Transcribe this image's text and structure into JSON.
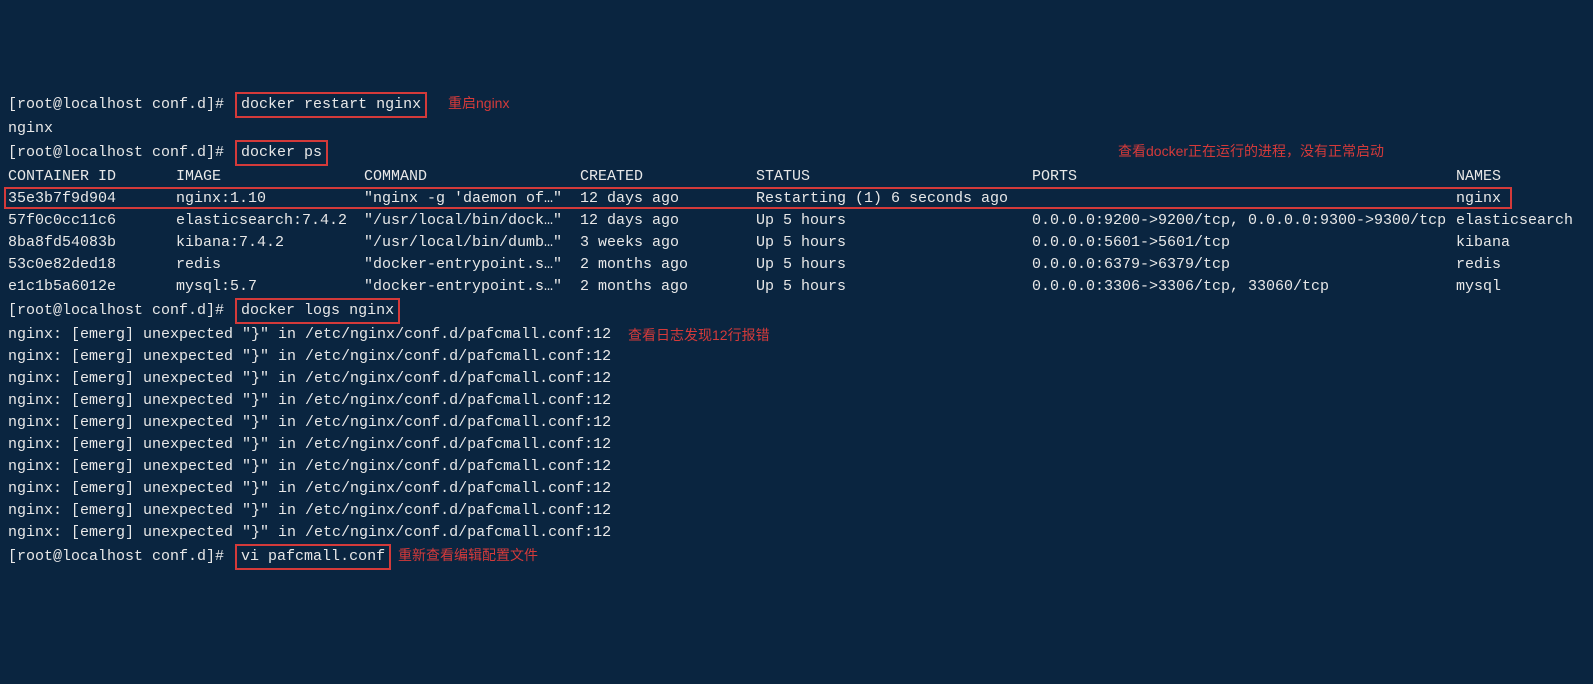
{
  "prompt": "[root@localhost conf.d]# ",
  "cmd1": "docker restart nginx",
  "note1": "重启nginx",
  "out1": "nginx",
  "cmd2": "docker ps",
  "note2": "查看docker正在运行的进程，没有正常启动",
  "headers": {
    "id": "CONTAINER ID",
    "image": "IMAGE",
    "command": "COMMAND",
    "created": "CREATED",
    "status": "STATUS",
    "ports": "PORTS",
    "names": "NAMES"
  },
  "rows": [
    {
      "id": "35e3b7f9d904",
      "image": "nginx:1.10",
      "command": "\"nginx -g 'daemon of…\"",
      "created": "12 days ago",
      "status": "Restarting (1) 6 seconds ago",
      "ports": "",
      "names": "nginx"
    },
    {
      "id": "57f0c0cc11c6",
      "image": "elasticsearch:7.4.2",
      "command": "\"/usr/local/bin/dock…\"",
      "created": "12 days ago",
      "status": "Up 5 hours",
      "ports": "0.0.0.0:9200->9200/tcp, 0.0.0.0:9300->9300/tcp",
      "names": "elasticsearch"
    },
    {
      "id": "8ba8fd54083b",
      "image": "kibana:7.4.2",
      "command": "\"/usr/local/bin/dumb…\"",
      "created": "3 weeks ago",
      "status": "Up 5 hours",
      "ports": "0.0.0.0:5601->5601/tcp",
      "names": "kibana"
    },
    {
      "id": "53c0e82ded18",
      "image": "redis",
      "command": "\"docker-entrypoint.s…\"",
      "created": "2 months ago",
      "status": "Up 5 hours",
      "ports": "0.0.0.0:6379->6379/tcp",
      "names": "redis"
    },
    {
      "id": "e1c1b5a6012e",
      "image": "mysql:5.7",
      "command": "\"docker-entrypoint.s…\"",
      "created": "2 months ago",
      "status": "Up 5 hours",
      "ports": "0.0.0.0:3306->3306/tcp, 33060/tcp",
      "names": "mysql"
    }
  ],
  "cmd3": "docker logs nginx",
  "note3": "查看日志发现12行报错",
  "log_line": "nginx: [emerg] unexpected \"}\" in /etc/nginx/conf.d/pafcmall.conf:12",
  "log_repeat": 10,
  "cmd4": "vi pafcmall.conf",
  "note4": "重新查看编辑配置文件"
}
